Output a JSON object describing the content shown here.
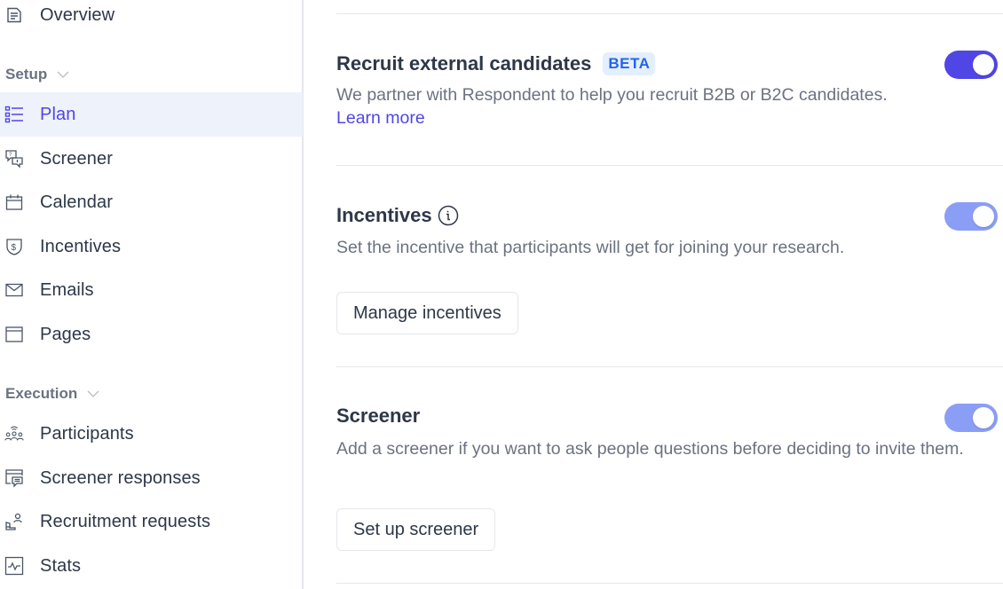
{
  "sidebar": {
    "top_item": {
      "label": "Overview",
      "icon": "document-icon"
    },
    "sections": [
      {
        "header": "Setup",
        "items": [
          {
            "label": "Plan",
            "icon": "list-icon",
            "active": true
          },
          {
            "label": "Screener",
            "icon": "chat-question-icon"
          },
          {
            "label": "Calendar",
            "icon": "calendar-icon"
          },
          {
            "label": "Incentives",
            "icon": "shield-dollar-icon"
          },
          {
            "label": "Emails",
            "icon": "envelope-icon"
          },
          {
            "label": "Pages",
            "icon": "browser-window-icon"
          }
        ]
      },
      {
        "header": "Execution",
        "items": [
          {
            "label": "Participants",
            "icon": "people-group-icon"
          },
          {
            "label": "Screener responses",
            "icon": "window-chat-icon"
          },
          {
            "label": "Recruitment requests",
            "icon": "recruit-person-icon"
          },
          {
            "label": "Stats",
            "icon": "activity-chart-icon"
          }
        ]
      }
    ]
  },
  "main": {
    "sections": [
      {
        "title": "Recruit external candidates",
        "badge": "BETA",
        "description": "We partner with Respondent to help you recruit B2B or B2C candidates.",
        "link": "Learn more",
        "toggle_on": true
      },
      {
        "title": "Incentives",
        "info_icon": "info-icon",
        "description": "Set the incentive that participants will get for joining your research.",
        "button": "Manage incentives",
        "toggle_on": true
      },
      {
        "title": "Screener",
        "description": "Add a screener if you want to ask people questions before deciding to invite them.",
        "button": "Set up screener",
        "toggle_on": true
      }
    ]
  },
  "colors": {
    "accent": "#5046e5",
    "toggle_soft": "#8b9ef5",
    "badge_bg": "#e3effd",
    "badge_text": "#2563eb",
    "active_bg": "#eef2fb"
  }
}
